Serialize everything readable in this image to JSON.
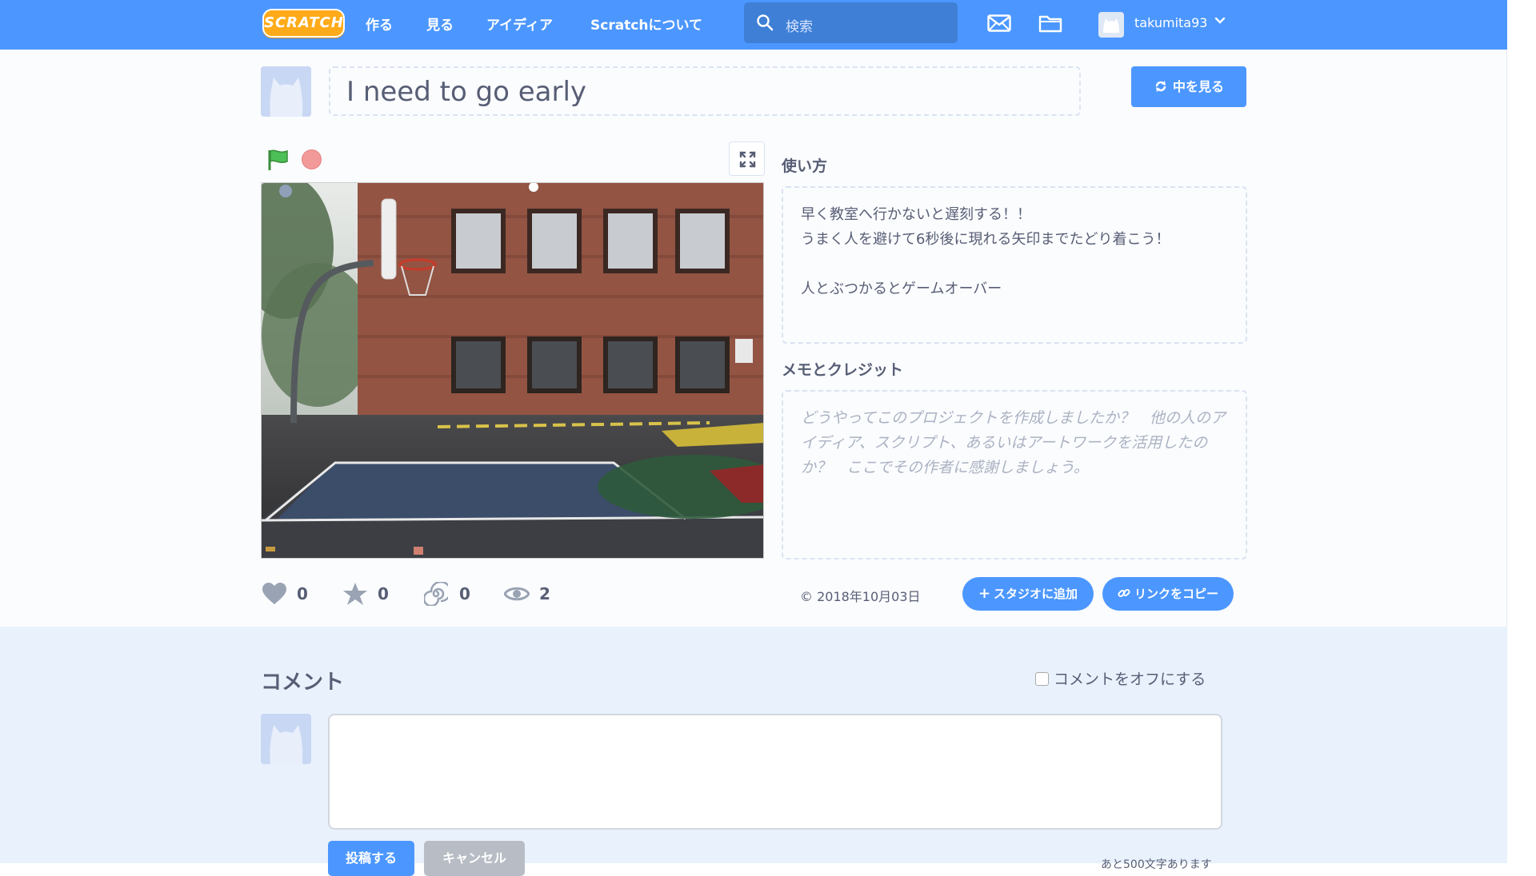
{
  "nav": {
    "logo": "SCRATCH",
    "links": [
      "作る",
      "見る",
      "アイディア",
      "Scratchについて"
    ],
    "search_placeholder": "検索",
    "username": "takumita93"
  },
  "project": {
    "title": "I need to go early",
    "see_inside": "中を見る",
    "instructions_heading": "使い方",
    "instructions": "早く教室へ行かないと遅刻する！！\nうまく人を避けて6秒後に現れる矢印までたどり着こう！\n\n人とぶつかるとゲームオーバー",
    "notes_heading": "メモとクレジット",
    "notes_placeholder": "どうやってこのプロジェクトを作成しましたか？　他の人のアイディア、スクリプト、あるいはアートワークを活用したのか？　ここでその作者に感謝しましょう。",
    "date": "© 2018年10月03日",
    "add_to_studio": "スタジオに追加",
    "copy_link": "リンクをコピー",
    "stats": {
      "loves": "0",
      "favorites": "0",
      "remixes": "0",
      "views": "2"
    }
  },
  "comments": {
    "heading": "コメント",
    "turn_off": "コメントをオフにする",
    "post": "投稿する",
    "cancel": "キャンセル",
    "remaining": "あと500文字あります"
  },
  "colors": {
    "accent": "#4c97ff",
    "text": "#575e75",
    "comments_bg": "#e9f1fc"
  }
}
